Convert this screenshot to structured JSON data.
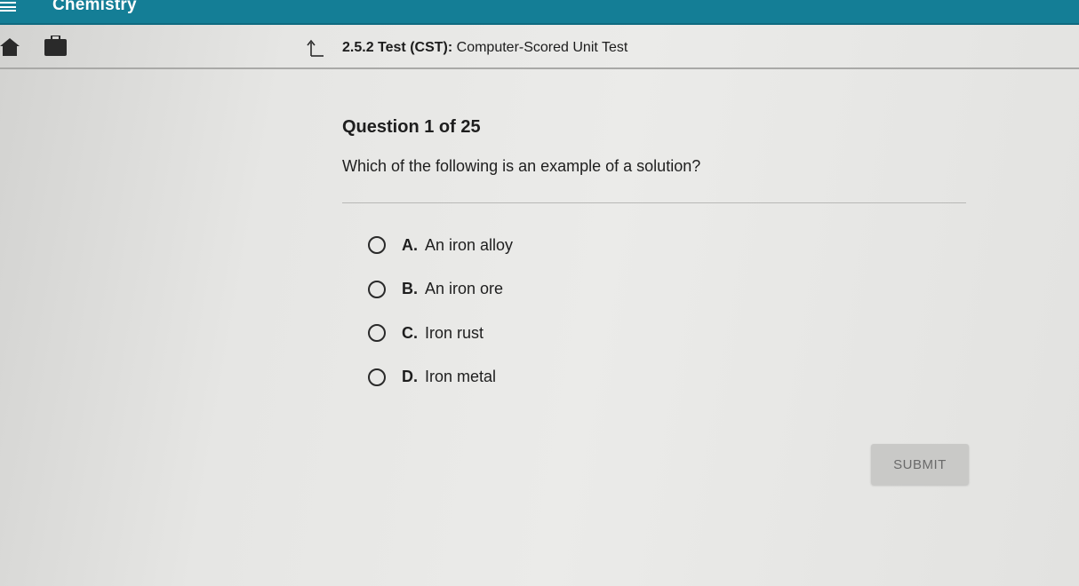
{
  "header": {
    "course_title": "Chemistry",
    "menu_icon": "menu-icon"
  },
  "nav": {
    "home_icon": "home-icon",
    "briefcase_icon": "briefcase-icon",
    "back_icon": "back-arrow-icon",
    "activity_code": "2.5.2",
    "activity_name": "Test (CST):",
    "activity_subtitle": "Computer-Scored Unit Test"
  },
  "question": {
    "number_label": "Question 1 of 25",
    "prompt": "Which of the following is an example of a solution?",
    "options": [
      {
        "letter": "A.",
        "text": "An iron alloy"
      },
      {
        "letter": "B.",
        "text": "An iron ore"
      },
      {
        "letter": "C.",
        "text": "Iron rust"
      },
      {
        "letter": "D.",
        "text": "Iron metal"
      }
    ]
  },
  "actions": {
    "submit_label": "SUBMIT"
  },
  "colors": {
    "top_bar": "#147e96",
    "background": "#e6e6e4",
    "submit_bg": "#c9c9c7"
  }
}
